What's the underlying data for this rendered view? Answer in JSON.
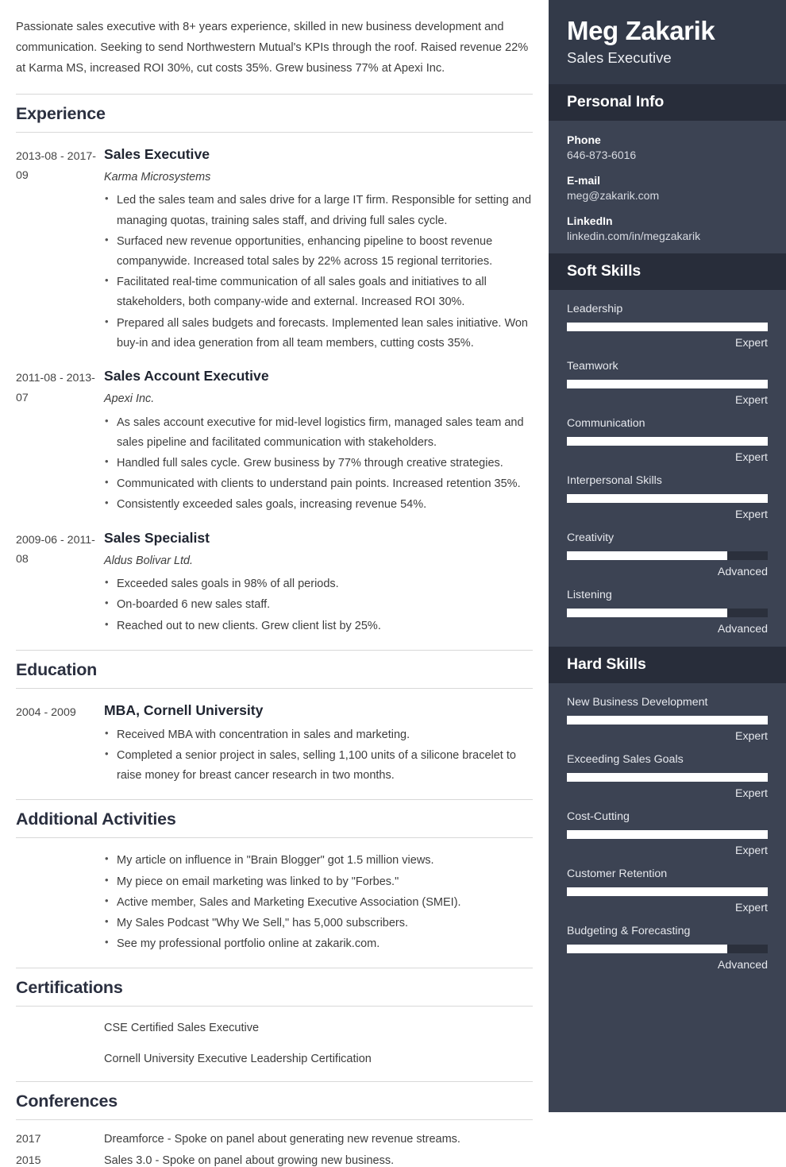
{
  "summary": "Passionate sales executive with 8+ years experience, skilled in new business development and communication. Seeking to send Northwestern Mutual's KPIs through the roof. Raised revenue 22% at Karma MS, increased ROI 30%, cut costs 35%. Grew business 77% at Apexi Inc.",
  "sections": {
    "experience_title": "Experience",
    "education_title": "Education",
    "activities_title": "Additional Activities",
    "certifications_title": "Certifications",
    "conferences_title": "Conferences"
  },
  "experience": [
    {
      "dates": "2013-08 - 2017-09",
      "title": "Sales Executive",
      "org": "Karma Microsystems",
      "bullets": [
        "Led the sales team and sales drive for a large IT firm. Responsible for setting and managing quotas, training sales staff, and driving full sales cycle.",
        "Surfaced new revenue opportunities, enhancing pipeline to boost revenue companywide. Increased total sales by 22% across 15 regional territories.",
        "Facilitated real-time communication of all sales goals and initiatives to all stakeholders, both company-wide and external. Increased ROI 30%.",
        "Prepared all sales budgets and forecasts. Implemented lean sales initiative. Won buy-in and idea generation from all team members, cutting costs 35%."
      ]
    },
    {
      "dates": "2011-08 - 2013-07",
      "title": "Sales Account Executive",
      "org": "Apexi Inc.",
      "bullets": [
        "As sales account executive for mid-level logistics firm, managed sales team and sales pipeline and facilitated communication with stakeholders.",
        "Handled full sales cycle. Grew business by 77% through creative strategies.",
        "Communicated with clients to understand pain points. Increased retention 35%.",
        "Consistently exceeded sales goals, increasing revenue 54%."
      ]
    },
    {
      "dates": "2009-06 - 2011-08",
      "title": "Sales Specialist",
      "org": "Aldus Bolivar Ltd.",
      "bullets": [
        "Exceeded sales goals in 98% of all periods.",
        "On-boarded 6 new sales staff.",
        "Reached out to new clients. Grew client list by 25%."
      ]
    }
  ],
  "education": [
    {
      "dates": "2004 - 2009",
      "title": "MBA, Cornell University",
      "bullets": [
        "Received MBA with concentration in sales and marketing.",
        "Completed a senior project in sales, selling 1,100 units of a silicone bracelet to raise money for breast cancer research in two months."
      ]
    }
  ],
  "activities": [
    "My article on influence in \"Brain Blogger\" got 1.5 million views.",
    "My piece on email marketing was linked to by \"Forbes.\"",
    "Active member, Sales and Marketing Executive Association (SMEI).",
    "My Sales Podcast \"Why We Sell,\" has 5,000 subscribers.",
    "See my professional portfolio online at zakarik.com."
  ],
  "certifications": [
    "CSE Certified Sales Executive",
    "Cornell University Executive Leadership Certification"
  ],
  "conferences": [
    {
      "year": "2017",
      "text": "Dreamforce - Spoke on panel about generating new revenue streams."
    },
    {
      "year": "2015",
      "text": "Sales 3.0 - Spoke on panel about growing new business."
    }
  ],
  "sidebar": {
    "name": "Meg Zakarik",
    "role": "Sales Executive",
    "personal_info_title": "Personal Info",
    "personal_info": [
      {
        "label": "Phone",
        "value": "646-873-6016"
      },
      {
        "label": "E-mail",
        "value": "meg@zakarik.com"
      },
      {
        "label": "LinkedIn",
        "value": "linkedin.com/in/megzakarik"
      }
    ],
    "soft_skills_title": "Soft Skills",
    "soft_skills": [
      {
        "name": "Leadership",
        "level": "Expert",
        "percent": 100
      },
      {
        "name": "Teamwork",
        "level": "Expert",
        "percent": 100
      },
      {
        "name": "Communication",
        "level": "Expert",
        "percent": 100
      },
      {
        "name": "Interpersonal Skills",
        "level": "Expert",
        "percent": 100
      },
      {
        "name": "Creativity",
        "level": "Advanced",
        "percent": 80
      },
      {
        "name": "Listening",
        "level": "Advanced",
        "percent": 80
      }
    ],
    "hard_skills_title": "Hard Skills",
    "hard_skills": [
      {
        "name": "New Business Development",
        "level": "Expert",
        "percent": 100
      },
      {
        "name": "Exceeding Sales Goals",
        "level": "Expert",
        "percent": 100
      },
      {
        "name": "Cost-Cutting",
        "level": "Expert",
        "percent": 100
      },
      {
        "name": "Customer Retention",
        "level": "Expert",
        "percent": 100
      },
      {
        "name": "Budgeting & Forecasting",
        "level": "Advanced",
        "percent": 80
      }
    ]
  },
  "colors": {
    "sidebar_bg": "#3c4353",
    "sidebar_header_bg": "#333a49",
    "sidebar_section_bg": "#282d3a",
    "bar_fill": "#ffffff",
    "bar_track": "#2b303c",
    "heading": "#2b3040",
    "rule": "#d8d8d8"
  }
}
